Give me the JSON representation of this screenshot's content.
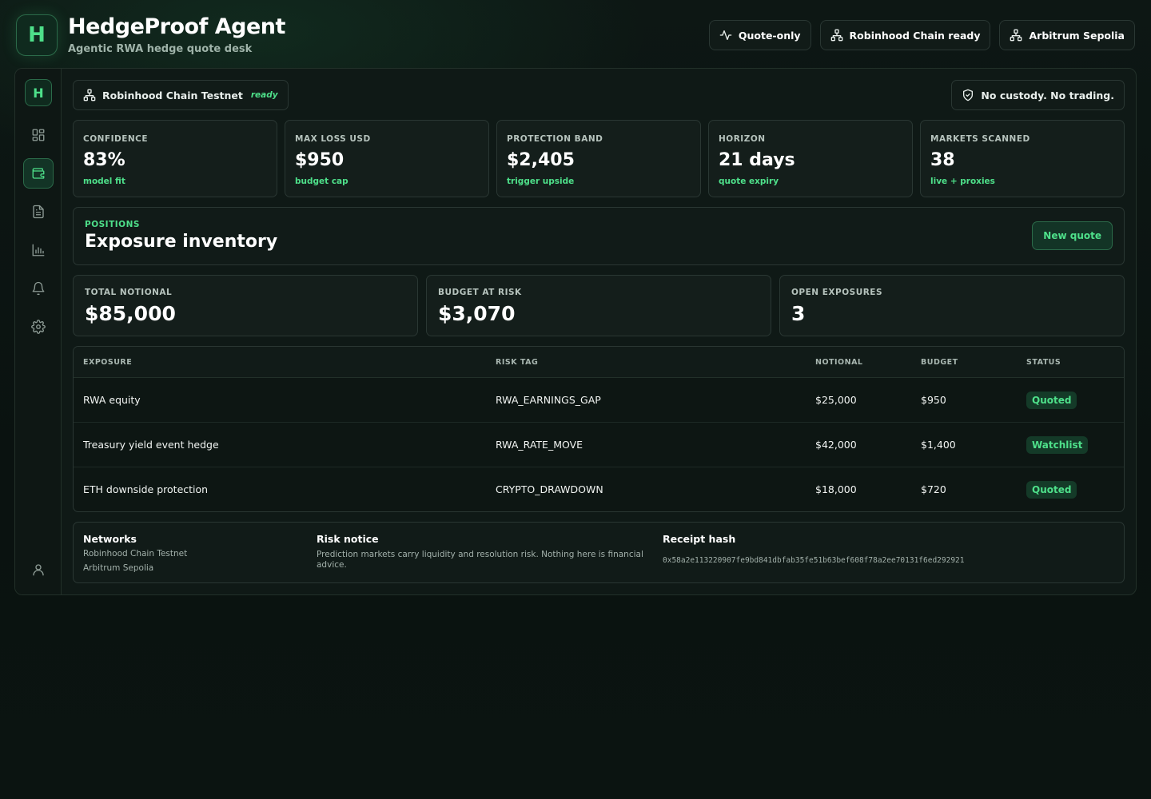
{
  "app": {
    "logo_letter": "H",
    "title": "HedgeProof Agent",
    "subtitle": "Agentic RWA hedge quote desk"
  },
  "header_pills": [
    {
      "icon": "activity-icon",
      "label": "Quote-only"
    },
    {
      "icon": "network-icon",
      "label": "Robinhood Chain ready"
    },
    {
      "icon": "network-icon",
      "label": "Arbitrum Sepolia"
    }
  ],
  "rail": {
    "logo_letter": "H",
    "items": [
      {
        "icon": "dashboard-icon",
        "active": false
      },
      {
        "icon": "wallet-icon",
        "active": true
      },
      {
        "icon": "document-icon",
        "active": false
      },
      {
        "icon": "bar-chart-icon",
        "active": false
      },
      {
        "icon": "bell-icon",
        "active": false
      },
      {
        "icon": "gear-icon",
        "active": false
      },
      {
        "icon": "user-icon",
        "active": false
      }
    ]
  },
  "network_chip": {
    "label": "Robinhood Chain Testnet",
    "status": "ready"
  },
  "custody_chip": {
    "label": "No custody. No trading."
  },
  "stats": [
    {
      "label": "Confidence",
      "value": "83%",
      "note": "model fit"
    },
    {
      "label": "Max loss USD",
      "value": "$950",
      "note": "budget cap"
    },
    {
      "label": "Protection band",
      "value": "$2,405",
      "note": "trigger upside"
    },
    {
      "label": "Horizon",
      "value": "21 days",
      "note": "quote expiry"
    },
    {
      "label": "Markets scanned",
      "value": "38",
      "note": "live + proxies"
    }
  ],
  "positions": {
    "eyebrow": "POSITIONS",
    "title": "Exposure inventory",
    "new_quote_label": "New quote"
  },
  "totals": [
    {
      "label": "Total notional",
      "value": "$85,000"
    },
    {
      "label": "Budget at risk",
      "value": "$3,070"
    },
    {
      "label": "Open exposures",
      "value": "3"
    }
  ],
  "table": {
    "headers": {
      "exposure": "Exposure",
      "risk_tag": "Risk tag",
      "notional": "Notional",
      "budget": "Budget",
      "status": "Status"
    },
    "rows": [
      {
        "exposure": "RWA equity",
        "risk_tag": "RWA_EARNINGS_GAP",
        "notional": "$25,000",
        "budget": "$950",
        "status": "Quoted"
      },
      {
        "exposure": "Treasury yield event hedge",
        "risk_tag": "RWA_RATE_MOVE",
        "notional": "$42,000",
        "budget": "$1,400",
        "status": "Watchlist"
      },
      {
        "exposure": "ETH downside protection",
        "risk_tag": "CRYPTO_DRAWDOWN",
        "notional": "$18,000",
        "budget": "$720",
        "status": "Quoted"
      }
    ]
  },
  "footer": {
    "networks_title": "Networks",
    "networks": [
      "Robinhood Chain Testnet",
      "Arbitrum Sepolia"
    ],
    "risk_title": "Risk notice",
    "risk_text": "Prediction markets carry liquidity and resolution risk. Nothing here is financial advice.",
    "receipt_title": "Receipt hash",
    "receipt_hash": "0x58a2e113220907fe9bd841dbfab35fe51b63bef608f78a2ee70131f6ed292921"
  },
  "colors": {
    "accent": "#4ee08a",
    "background": "#0b1310",
    "card": "#141e1b",
    "border": "#2a3733"
  }
}
